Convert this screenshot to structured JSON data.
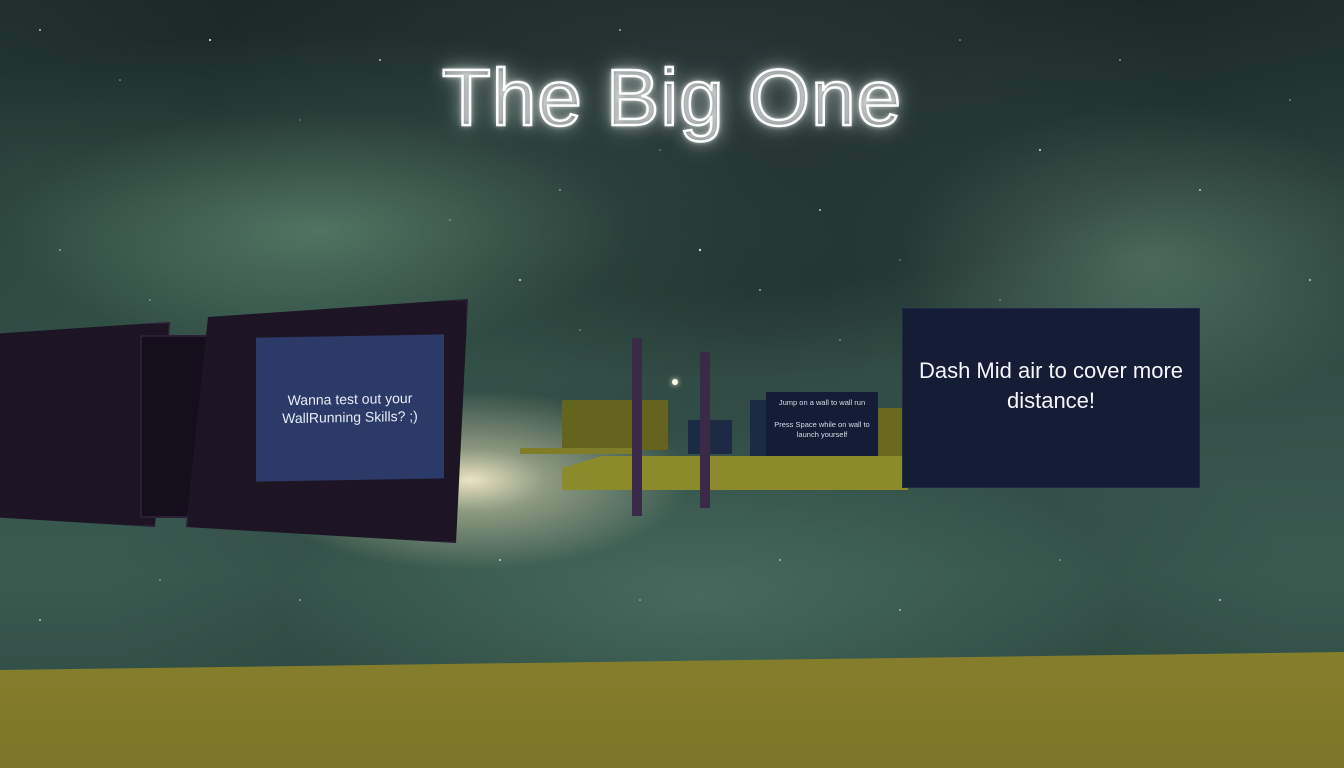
{
  "game": {
    "title": "The Big One",
    "signs": {
      "wallrun": "Wanna test out your WallRunning Skills? ;)",
      "dash": "Dash Mid air to cover more distance!",
      "distant_line1": "Jump on a wall to wall run",
      "distant_line2": "Press Space while on wall to launch yourself"
    }
  },
  "colors": {
    "ground": "#857f2c",
    "sky": "#2a423b",
    "wall": "#1d1524",
    "sign_panel": "#151d36",
    "title_glow": "#ffffff"
  }
}
